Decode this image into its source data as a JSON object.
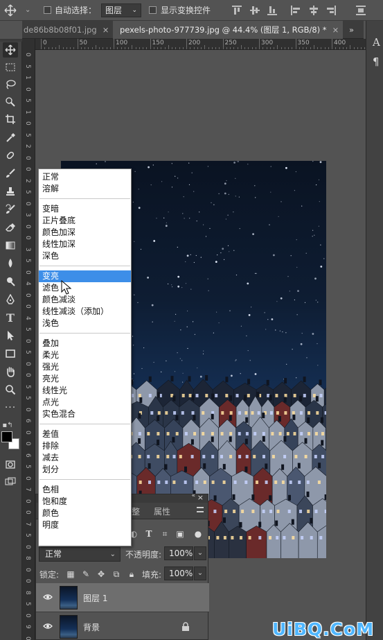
{
  "options_bar": {
    "auto_select_label": "自动选择：",
    "auto_select_target": "图层",
    "show_transform_label": "显示变换控件"
  },
  "tabs": [
    {
      "label": "de86b8b08f01.jpg",
      "close": "×"
    },
    {
      "label": "pexels-photo-977739.jpg @ 44.4% (图层 1, RGB/8) *",
      "close": "×"
    },
    {
      "label": "»"
    }
  ],
  "right_panel": {
    "char_icon_label": "A",
    "para_icon_label": "¶"
  },
  "ruler": {
    "h_labels": [
      "0",
      "50",
      "100",
      "150",
      "200",
      "250",
      "300",
      "350",
      "400",
      "450"
    ],
    "v_labels": [
      "0",
      "5",
      "1",
      "0",
      "5",
      "1",
      "0",
      "5",
      "2",
      "0",
      "0",
      "2",
      "5",
      "0",
      "3",
      "0",
      "0",
      "3",
      "5",
      "0",
      "4",
      "0",
      "0",
      "4",
      "5",
      "0",
      "5",
      "0",
      "0",
      "5",
      "5",
      "0",
      "6",
      "0",
      "0",
      "6",
      "5",
      "0",
      "7",
      "0",
      "0",
      "7",
      "5",
      "0",
      "8",
      "0",
      "0",
      "8",
      "5",
      "0",
      "9",
      "0",
      "0"
    ]
  },
  "toolbar": {
    "tools": [
      "move-icon",
      "marquee-icon",
      "lasso-icon",
      "quick-select-icon",
      "crop-icon",
      "eyedropper-icon",
      "healing-icon",
      "brush-icon",
      "clone-stamp-icon",
      "history-brush-icon",
      "eraser-icon",
      "gradient-icon",
      "blur-icon",
      "dodge-icon",
      "pen-icon",
      "type-icon",
      "path-select-icon",
      "rectangle-icon",
      "hand-icon",
      "zoom-icon",
      "more-icon"
    ],
    "foreground_color": "#000000",
    "background_color": "#ffffff"
  },
  "blend_menu": {
    "groups": [
      [
        "正常",
        "溶解"
      ],
      [
        "变暗",
        "正片叠底",
        "颜色加深",
        "线性加深",
        "深色"
      ],
      [
        "变亮",
        "滤色",
        "颜色减淡",
        "线性减淡（添加）",
        "浅色"
      ],
      [
        "叠加",
        "柔光",
        "强光",
        "亮光",
        "线性光",
        "点光",
        "实色混合"
      ],
      [
        "差值",
        "排除",
        "减去",
        "划分"
      ],
      [
        "色相",
        "饱和度",
        "颜色",
        "明度"
      ]
    ],
    "highlighted": "变亮"
  },
  "layers_panel": {
    "close": "×",
    "tab_partial": "整",
    "tab_properties": "属性",
    "blend_mode": "正常",
    "opacity_label": "不透明度:",
    "opacity_value": "100%",
    "lock_label": "锁定:",
    "fill_label": "填充:",
    "fill_value": "100%",
    "layers": [
      {
        "name": "图层",
        "suffix": "1",
        "selected": true,
        "locked": false
      },
      {
        "name": "背景",
        "suffix": "",
        "selected": false,
        "locked": true
      }
    ]
  },
  "watermark": "UiBQ.CoM",
  "colors": {
    "menu_highlight": "#3d8ee8",
    "app_bg": "#535353",
    "panel_dark": "#424242",
    "watermark": "#4fb6ff"
  }
}
